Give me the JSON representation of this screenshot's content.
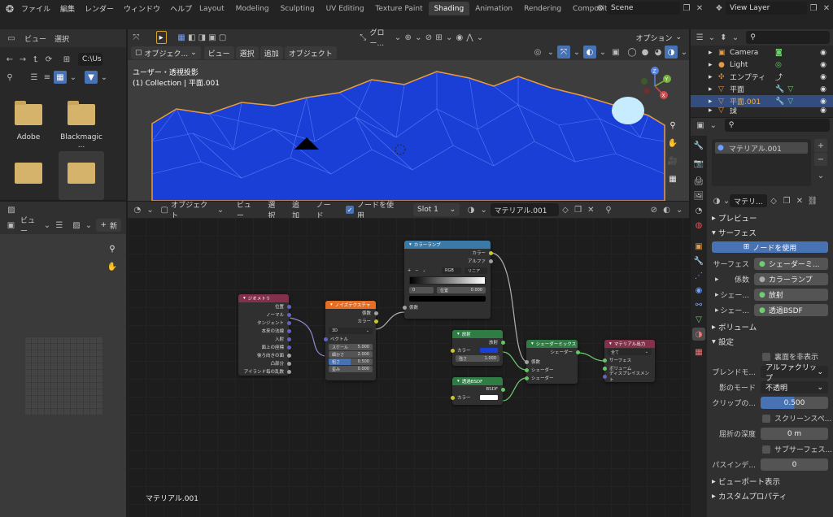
{
  "topbar": {
    "menus": [
      "ファイル",
      "編集",
      "レンダー",
      "ウィンドウ",
      "ヘルプ"
    ],
    "tabs": [
      "Layout",
      "Modeling",
      "Sculpting",
      "UV Editing",
      "Texture Paint",
      "Shading",
      "Animation",
      "Rendering",
      "Compositing"
    ],
    "active_tab": "Shading",
    "scene": "Scene",
    "view_layer": "View Layer"
  },
  "file_browser": {
    "menus": [
      "ビュー",
      "選択"
    ],
    "path": "C:\\Us",
    "folders": [
      "Adobe",
      "Blackmagic ..."
    ]
  },
  "image_editor": {
    "view_menu": "ビュー",
    "new_button": "新"
  },
  "viewport": {
    "mode": "オブジェク...",
    "menus": [
      "ビュー",
      "選択",
      "追加",
      "オブジェクト"
    ],
    "transform_orientation": "グロー...",
    "options": "オプション",
    "overlay_title": "ユーザー・透視投影",
    "overlay_sub": "(1) Collection | 平面.001"
  },
  "node_editor": {
    "mode": "オブジェクト",
    "menus": [
      "ビュー",
      "選択",
      "追加",
      "ノード"
    ],
    "use_nodes_label": "ノードを使用",
    "slot": "Slot 1",
    "material": "マテリアル.001",
    "footer_label": "マテリアル.001",
    "nodes": {
      "geometry": {
        "title": "ジオメトリ",
        "outputs": [
          "位置",
          "ノーマル",
          "タンジェント",
          "本来の法線",
          "入射",
          "面上の座標",
          "後ろ向きの面",
          "凸部分",
          "アイランド毎の乱数"
        ]
      },
      "noise": {
        "title": "ノイズテクスチャ",
        "outputs": [
          "係数",
          "カラー"
        ],
        "dim": "3D",
        "inputs": [
          "ベクトル"
        ],
        "fields": [
          {
            "label": "スケール",
            "value": "5.000"
          },
          {
            "label": "細かさ",
            "value": "2.000"
          },
          {
            "label": "粗さ",
            "value": "0.500"
          },
          {
            "label": "歪み",
            "value": "0.000"
          }
        ]
      },
      "ramp": {
        "title": "カラーランプ",
        "outputs": [
          "カラー",
          "アルファ"
        ],
        "mode": "RGB",
        "interp": "リニア",
        "index": "0",
        "pos_label": "位置",
        "pos_value": "0.000",
        "inputs": [
          "係数"
        ]
      },
      "emission": {
        "title": "放射",
        "outputs": [
          "放射"
        ],
        "inputs": [
          "カラー"
        ],
        "strength_label": "強さ",
        "strength_value": "1.000"
      },
      "transparent": {
        "title": "透過BSDF",
        "outputs": [
          "BSDF"
        ],
        "inputs": [
          "カラー"
        ]
      },
      "mix": {
        "title": "シェーダーミックス",
        "outputs": [
          "シェーダー"
        ],
        "inputs": [
          "係数",
          "シェーダー",
          "シェーダー"
        ]
      },
      "output": {
        "title": "マテリアル出力",
        "target": "全て",
        "inputs": [
          "サーフェス",
          "ボリューム",
          "ディスプレイスメント"
        ]
      }
    }
  },
  "outliner": {
    "items": [
      {
        "name": "Camera"
      },
      {
        "name": "Light"
      },
      {
        "name": "エンプティ"
      },
      {
        "name": "平面"
      },
      {
        "name": "平面.001",
        "selected": true
      },
      {
        "name": "球"
      }
    ]
  },
  "properties": {
    "material_slot": "マテリアル.001",
    "material_name": "マテリ...",
    "sections": {
      "preview": "プレビュー",
      "surface": "サーフェス",
      "volume": "ボリューム",
      "settings": "設定",
      "viewport": "ビューポート表示",
      "custom": "カスタムプロパティ"
    },
    "use_nodes": "ノードを使用",
    "surface_label": "サーフェス",
    "surface_value": "シェーダーミ...",
    "fac_label": "係数",
    "fac_value": "カラーランプ",
    "shader1_label": "シェー...",
    "shader1_value": "放射",
    "shader2_label": "シェー...",
    "shader2_value": "透過BSDF",
    "backface": "裏面を非表示",
    "blend_label": "ブレンドモ...",
    "blend_value": "アルファクリップ",
    "shadow_label": "影のモード",
    "shadow_value": "不透明",
    "clip_label": "クリップの...",
    "clip_value": "0.500",
    "clip_fill": 0.5,
    "screenspace": "スクリーンスペ...",
    "refr_label": "屈折の深度",
    "refr_value": "0 m",
    "subsurface": "サブサーフェス...",
    "pass_label": "パスインデ...",
    "pass_value": "0"
  },
  "colors": {
    "accent": "#4772b3",
    "geometry": "#83314a",
    "texture": "#e66e24",
    "converter": "#3b7aa6",
    "shader": "#2f7c45",
    "output": "#83314a",
    "mesh_blue": "#1a3fd6"
  }
}
